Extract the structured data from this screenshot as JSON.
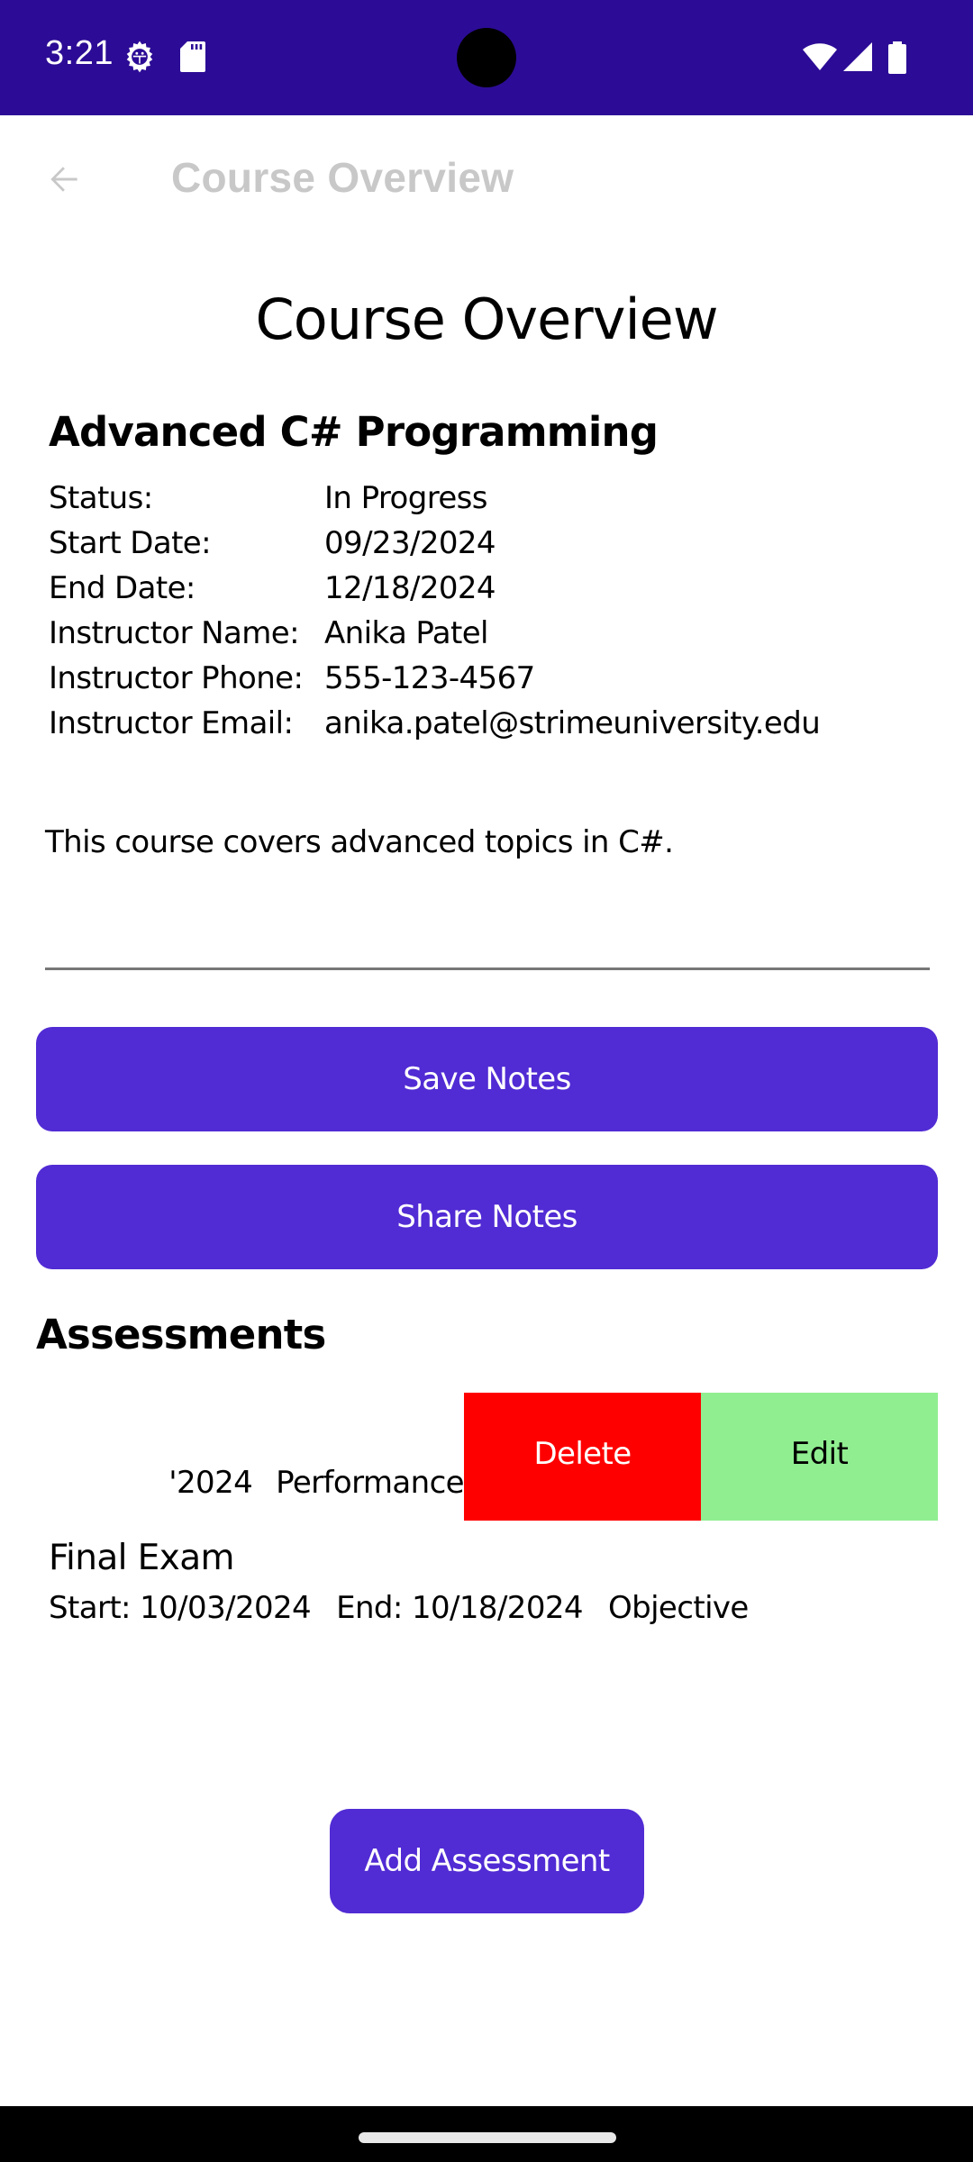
{
  "status_bar": {
    "time": "3:21",
    "left_icons": [
      "gear-icon",
      "sd-card-icon"
    ],
    "right_icons": [
      "wifi-icon",
      "cell-signal-icon",
      "battery-icon"
    ],
    "background_color": "#2c0c96"
  },
  "app_bar": {
    "back_icon": "arrow-left-icon",
    "title": "Course Overview",
    "title_color": "#c8c8c8"
  },
  "page": {
    "title": "Course Overview"
  },
  "course": {
    "name": "Advanced C# Programming",
    "details": [
      {
        "label": "Status:",
        "value": "In Progress"
      },
      {
        "label": "Start Date:",
        "value": "09/23/2024"
      },
      {
        "label": "End Date:",
        "value": "12/18/2024"
      },
      {
        "label": "Instructor Name:",
        "value": "Anika Patel"
      },
      {
        "label": "Instructor Phone:",
        "value": "555-123-4567"
      },
      {
        "label": "Instructor Email:",
        "value": "anika.patel@strimeuniversity.edu"
      }
    ]
  },
  "notes": {
    "value": "This course covers advanced topics in C#."
  },
  "buttons": {
    "save_notes": "Save Notes",
    "share_notes": "Share Notes",
    "add_assessment": "Add Assessment",
    "accent_color": "#512bd4"
  },
  "assessments": {
    "heading": "Assessments",
    "swiped_item": {
      "visible_meta_fragment": "'2024",
      "type": "Performance",
      "actions": {
        "delete": "Delete",
        "edit": "Edit",
        "delete_color": "#ff0000",
        "edit_color": "#90ee90"
      }
    },
    "items": [
      {
        "title": "Final Exam",
        "start": "Start: 10/03/2024",
        "end": "End: 10/18/2024",
        "type": "Objective"
      }
    ]
  }
}
